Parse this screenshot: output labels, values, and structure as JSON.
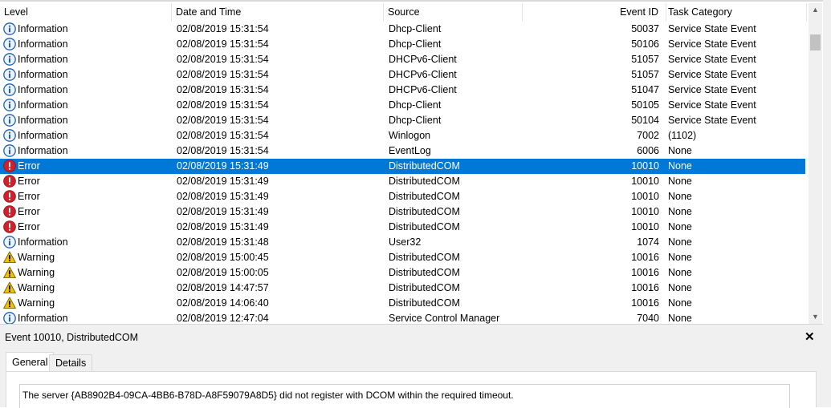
{
  "columns": {
    "level": "Level",
    "date": "Date and Time",
    "source": "Source",
    "event_id": "Event ID",
    "category": "Task Category"
  },
  "rows": [
    {
      "icon": "info-icon",
      "level": "Information",
      "date": "02/08/2019 15:31:54",
      "source": "Dhcp-Client",
      "id": "50037",
      "cat": "Service State Event"
    },
    {
      "icon": "info-icon",
      "level": "Information",
      "date": "02/08/2019 15:31:54",
      "source": "Dhcp-Client",
      "id": "50106",
      "cat": "Service State Event"
    },
    {
      "icon": "info-icon",
      "level": "Information",
      "date": "02/08/2019 15:31:54",
      "source": "DHCPv6-Client",
      "id": "51057",
      "cat": "Service State Event"
    },
    {
      "icon": "info-icon",
      "level": "Information",
      "date": "02/08/2019 15:31:54",
      "source": "DHCPv6-Client",
      "id": "51057",
      "cat": "Service State Event"
    },
    {
      "icon": "info-icon",
      "level": "Information",
      "date": "02/08/2019 15:31:54",
      "source": "DHCPv6-Client",
      "id": "51047",
      "cat": "Service State Event"
    },
    {
      "icon": "info-icon",
      "level": "Information",
      "date": "02/08/2019 15:31:54",
      "source": "Dhcp-Client",
      "id": "50105",
      "cat": "Service State Event"
    },
    {
      "icon": "info-icon",
      "level": "Information",
      "date": "02/08/2019 15:31:54",
      "source": "Dhcp-Client",
      "id": "50104",
      "cat": "Service State Event"
    },
    {
      "icon": "info-icon",
      "level": "Information",
      "date": "02/08/2019 15:31:54",
      "source": "Winlogon",
      "id": "7002",
      "cat": "(1102)"
    },
    {
      "icon": "info-icon",
      "level": "Information",
      "date": "02/08/2019 15:31:54",
      "source": "EventLog",
      "id": "6006",
      "cat": "None"
    },
    {
      "icon": "error-icon",
      "level": "Error",
      "date": "02/08/2019 15:31:49",
      "source": "DistributedCOM",
      "id": "10010",
      "cat": "None",
      "selected": true
    },
    {
      "icon": "error-icon",
      "level": "Error",
      "date": "02/08/2019 15:31:49",
      "source": "DistributedCOM",
      "id": "10010",
      "cat": "None"
    },
    {
      "icon": "error-icon",
      "level": "Error",
      "date": "02/08/2019 15:31:49",
      "source": "DistributedCOM",
      "id": "10010",
      "cat": "None"
    },
    {
      "icon": "error-icon",
      "level": "Error",
      "date": "02/08/2019 15:31:49",
      "source": "DistributedCOM",
      "id": "10010",
      "cat": "None"
    },
    {
      "icon": "error-icon",
      "level": "Error",
      "date": "02/08/2019 15:31:49",
      "source": "DistributedCOM",
      "id": "10010",
      "cat": "None"
    },
    {
      "icon": "info-icon",
      "level": "Information",
      "date": "02/08/2019 15:31:48",
      "source": "User32",
      "id": "1074",
      "cat": "None"
    },
    {
      "icon": "warning-icon",
      "level": "Warning",
      "date": "02/08/2019 15:00:45",
      "source": "DistributedCOM",
      "id": "10016",
      "cat": "None"
    },
    {
      "icon": "warning-icon",
      "level": "Warning",
      "date": "02/08/2019 15:00:05",
      "source": "DistributedCOM",
      "id": "10016",
      "cat": "None"
    },
    {
      "icon": "warning-icon",
      "level": "Warning",
      "date": "02/08/2019 14:47:57",
      "source": "DistributedCOM",
      "id": "10016",
      "cat": "None"
    },
    {
      "icon": "warning-icon",
      "level": "Warning",
      "date": "02/08/2019 14:06:40",
      "source": "DistributedCOM",
      "id": "10016",
      "cat": "None"
    },
    {
      "icon": "info-icon",
      "level": "Information",
      "date": "02/08/2019 12:47:04",
      "source": "Service Control Manager",
      "id": "7040",
      "cat": "None"
    }
  ],
  "colors": {
    "selection": "#0078d7",
    "info": "#1c5fb4",
    "error": "#d0202b",
    "warning": "#f2c200"
  },
  "detail": {
    "title": "Event 10010, DistributedCOM",
    "tabs": [
      "General",
      "Details"
    ],
    "message": "The server {AB8902B4-09CA-4BB6-B78D-A8F59079A8D5} did not register with DCOM within the required timeout."
  }
}
